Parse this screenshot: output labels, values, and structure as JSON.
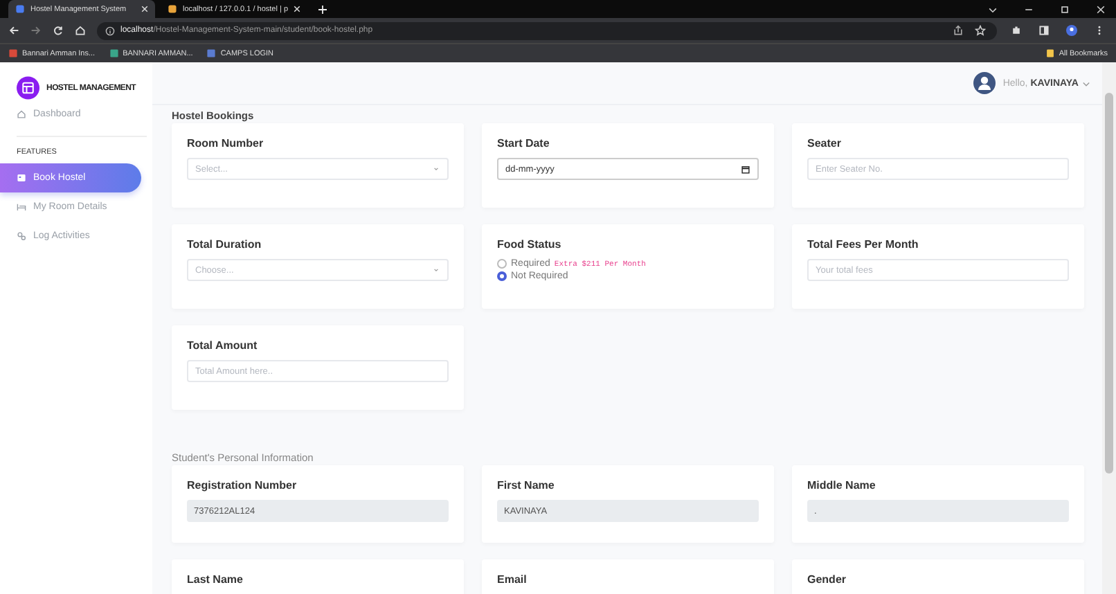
{
  "browser": {
    "tabs": [
      {
        "title": "Hostel Management System",
        "selected": true
      },
      {
        "title": "localhost / 127.0.0.1 / hostel | p",
        "selected": false
      }
    ],
    "address_bar": {
      "host": "localhost",
      "path": "/Hostel-Management-System-main/student/book-hostel.php"
    },
    "bookmarks": [
      "Bannari Amman Ins...",
      "BANNARI AMMAN...",
      "CAMPS LOGIN"
    ],
    "all_bookmarks": "All Bookmarks"
  },
  "sidebar": {
    "logo_text": "HOSTEL MANAGEMENT",
    "items": [
      {
        "kind": "link",
        "label": "Dashboard",
        "selected": false
      },
      {
        "kind": "heading",
        "label": "FEATURES"
      },
      {
        "kind": "link",
        "label": "Book Hostel",
        "selected": true
      },
      {
        "kind": "link",
        "label": "My Room Details",
        "selected": false
      },
      {
        "kind": "link",
        "label": "Log Activities",
        "selected": false
      }
    ]
  },
  "header": {
    "greeting": "Hello,",
    "user": "KAVINAYA"
  },
  "sections": [
    {
      "title": "Hostel Bookings",
      "fields": [
        {
          "label": "Room Number",
          "kind": "select",
          "placeholder": "Select..."
        },
        {
          "label": "Start Date",
          "kind": "date",
          "value": "dd-mm-yyyy"
        },
        {
          "label": "Seater",
          "kind": "input",
          "placeholder": "Enter Seater No."
        },
        {
          "label": "Total Duration",
          "kind": "select",
          "placeholder": "Choose..."
        },
        {
          "label": "Food Status",
          "kind": "radio",
          "options": [
            {
              "label": "Required",
              "note": "Extra $211 Per Month",
              "selected": false
            },
            {
              "label": "Not Required",
              "selected": true
            }
          ]
        },
        {
          "label": "Total Fees Per Month",
          "kind": "input",
          "placeholder": "Your total fees"
        },
        {
          "label": "Total Amount",
          "kind": "input",
          "placeholder": "Total Amount here.."
        }
      ]
    },
    {
      "title": "Student's Personal Information",
      "fields": [
        {
          "label": "Registration Number",
          "kind": "readonly",
          "value": "7376212AL124"
        },
        {
          "label": "First Name",
          "kind": "readonly",
          "value": "KAVINAYA"
        },
        {
          "label": "Middle Name",
          "kind": "readonly",
          "value": "."
        },
        {
          "label": "Last Name",
          "kind": "cut"
        },
        {
          "label": "Email",
          "kind": "cut"
        },
        {
          "label": "Gender",
          "kind": "cut"
        }
      ]
    }
  ]
}
